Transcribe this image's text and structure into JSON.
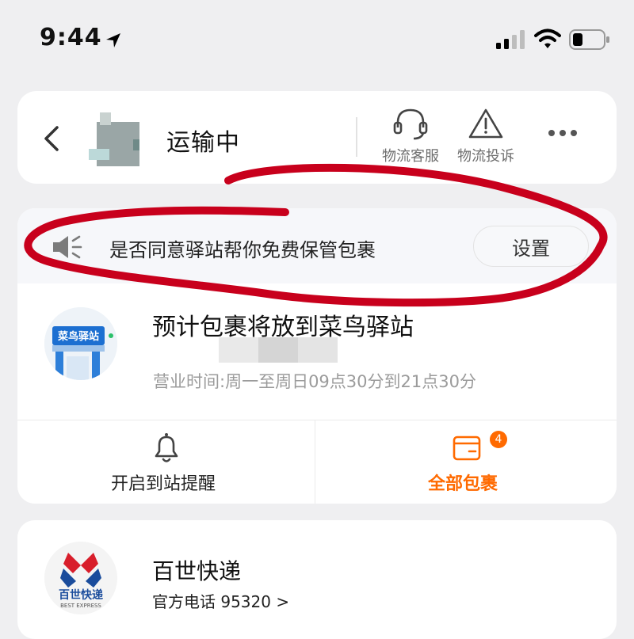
{
  "status_bar": {
    "time": "9:44"
  },
  "header": {
    "status": "运输中",
    "customer_service": "物流客服",
    "complaint": "物流投诉"
  },
  "notice": {
    "text": "是否同意驿站帮你免费保管包裹",
    "button": "设置"
  },
  "station": {
    "logo_text": "菜鸟驿站",
    "title": "预计包裹将放到菜鸟驿站",
    "hours": "营业时间:周一至周日09点30分到21点30分"
  },
  "actions": {
    "remind_label": "开启到站提醒",
    "all_packages_label": "全部包裹",
    "badge_count": "4"
  },
  "courier": {
    "name": "百世快递",
    "phone": "官方电话 95320 >",
    "logo_text_cn": "百世快递",
    "logo_text_en": "BEST EXPRESS"
  },
  "colors": {
    "accent": "#ff6a00",
    "annotation": "#c8001c"
  }
}
